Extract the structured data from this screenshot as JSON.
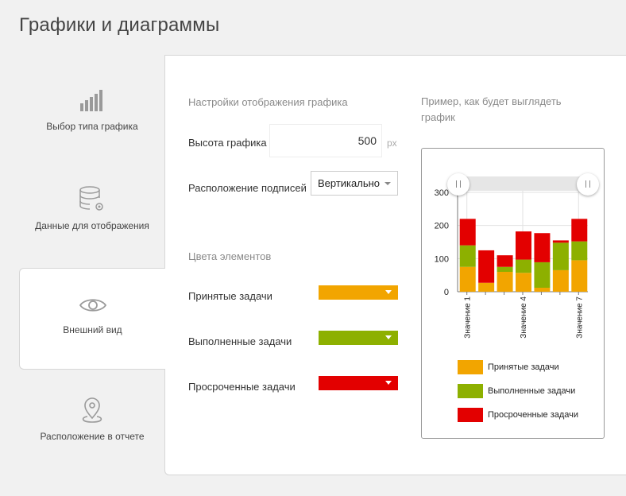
{
  "page": {
    "title": "Графики и диаграммы"
  },
  "nav": {
    "items": [
      {
        "label": "Выбор типа графика",
        "icon": "bar-chart-icon"
      },
      {
        "label": "Данные для отображения",
        "icon": "database-settings-icon"
      },
      {
        "label": "Внешний вид",
        "icon": "eye-icon",
        "active": true
      },
      {
        "label": "Расположение в отчете",
        "icon": "location-pin-icon"
      }
    ]
  },
  "settings": {
    "title": "Настройки отображения графика",
    "height_label": "Высота графика",
    "height_value": "500",
    "height_unit": "px",
    "labels_position_label": "Расположение подписей",
    "labels_position_value": "Вертикально"
  },
  "colors": {
    "title": "Цвета элементов",
    "items": [
      {
        "label": "Принятые задачи",
        "color": "#f2a500"
      },
      {
        "label": "Выполненные задачи",
        "color": "#8db000"
      },
      {
        "label": "Просроченные задачи",
        "color": "#e30000"
      }
    ]
  },
  "preview": {
    "title": "Пример, как будет выглядеть график"
  },
  "chart_data": {
    "type": "bar",
    "stacked": true,
    "categories": [
      "Значение 1",
      "",
      "",
      "Значение 4",
      "",
      "",
      "Значение 7"
    ],
    "series": [
      {
        "name": "Принятые задачи",
        "color": "#f2a500",
        "values": [
          75,
          27,
          60,
          57,
          12,
          65,
          95
        ]
      },
      {
        "name": "Выполненные задачи",
        "color": "#8db000",
        "values": [
          65,
          0,
          15,
          40,
          77,
          83,
          57
        ]
      },
      {
        "name": "Просроченные задачи",
        "color": "#e30000",
        "values": [
          80,
          98,
          35,
          85,
          88,
          7,
          68
        ]
      }
    ],
    "yticks": [
      0,
      100,
      200,
      300
    ],
    "ylim": [
      0,
      300
    ],
    "grid": true,
    "legend": "bottom"
  }
}
